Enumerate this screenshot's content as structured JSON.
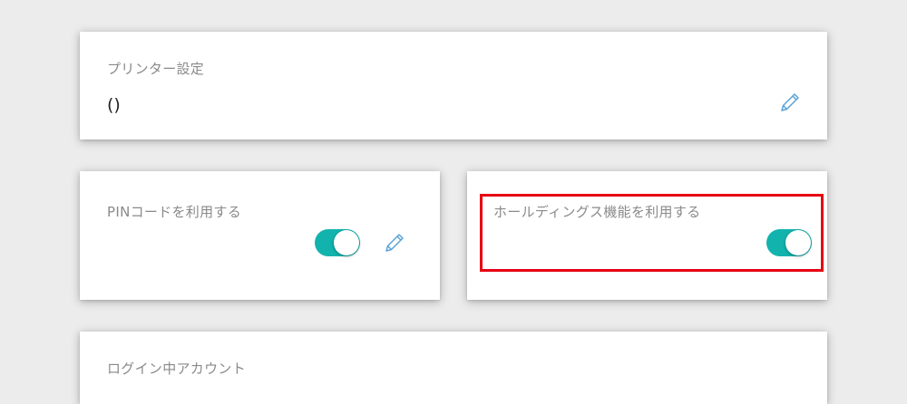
{
  "printer_card": {
    "label": "プリンター設定",
    "value": "()",
    "edit_icon": "pencil-icon"
  },
  "pin_card": {
    "label": "PINコードを利用する",
    "toggle_on": true,
    "edit_icon": "pencil-icon"
  },
  "holdings_card": {
    "label": "ホールディングス機能を利用する",
    "toggle_on": true,
    "highlighted": true
  },
  "account_card": {
    "label": "ログイン中アカウント"
  },
  "colors": {
    "background": "#ececec",
    "card": "#ffffff",
    "toggle_accent": "#13b3ad",
    "icon_accent": "#5aa3d6",
    "highlight": "#e60012",
    "label_text": "#8a8a8a"
  }
}
